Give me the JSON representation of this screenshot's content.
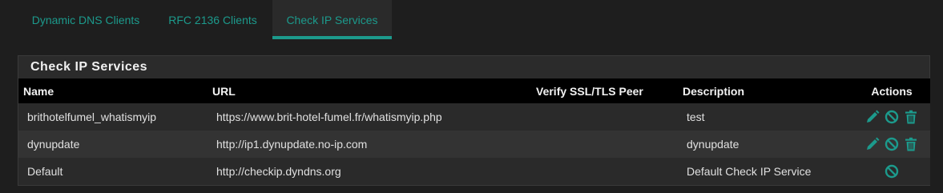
{
  "tabs": [
    {
      "label": "Dynamic DNS Clients",
      "active": false
    },
    {
      "label": "RFC 2136 Clients",
      "active": false
    },
    {
      "label": "Check IP Services",
      "active": true
    }
  ],
  "panel": {
    "title": "Check IP Services",
    "columns": [
      "Name",
      "URL",
      "Verify SSL/TLS Peer",
      "Description",
      "Actions"
    ],
    "rows": [
      {
        "name": "brithotelfumel_whatismyip",
        "url": "https://www.brit-hotel-fumel.fr/whatismyip.php",
        "verify": "",
        "description": "test",
        "actions": [
          "pencil-icon",
          "ban-icon",
          "trash-icon"
        ]
      },
      {
        "name": "dynupdate",
        "url": "http://ip1.dynupdate.no-ip.com",
        "verify": "",
        "description": "dynupdate",
        "actions": [
          "pencil-icon",
          "ban-icon",
          "trash-icon"
        ]
      },
      {
        "name": "Default",
        "url": "http://checkip.dyndns.org",
        "verify": "",
        "description": "Default Check IP Service",
        "actions": [
          "ban-icon"
        ]
      }
    ]
  },
  "colors": {
    "accent": "#1c9a8c",
    "background": "#1e1e1e",
    "header_row": "#000000"
  }
}
